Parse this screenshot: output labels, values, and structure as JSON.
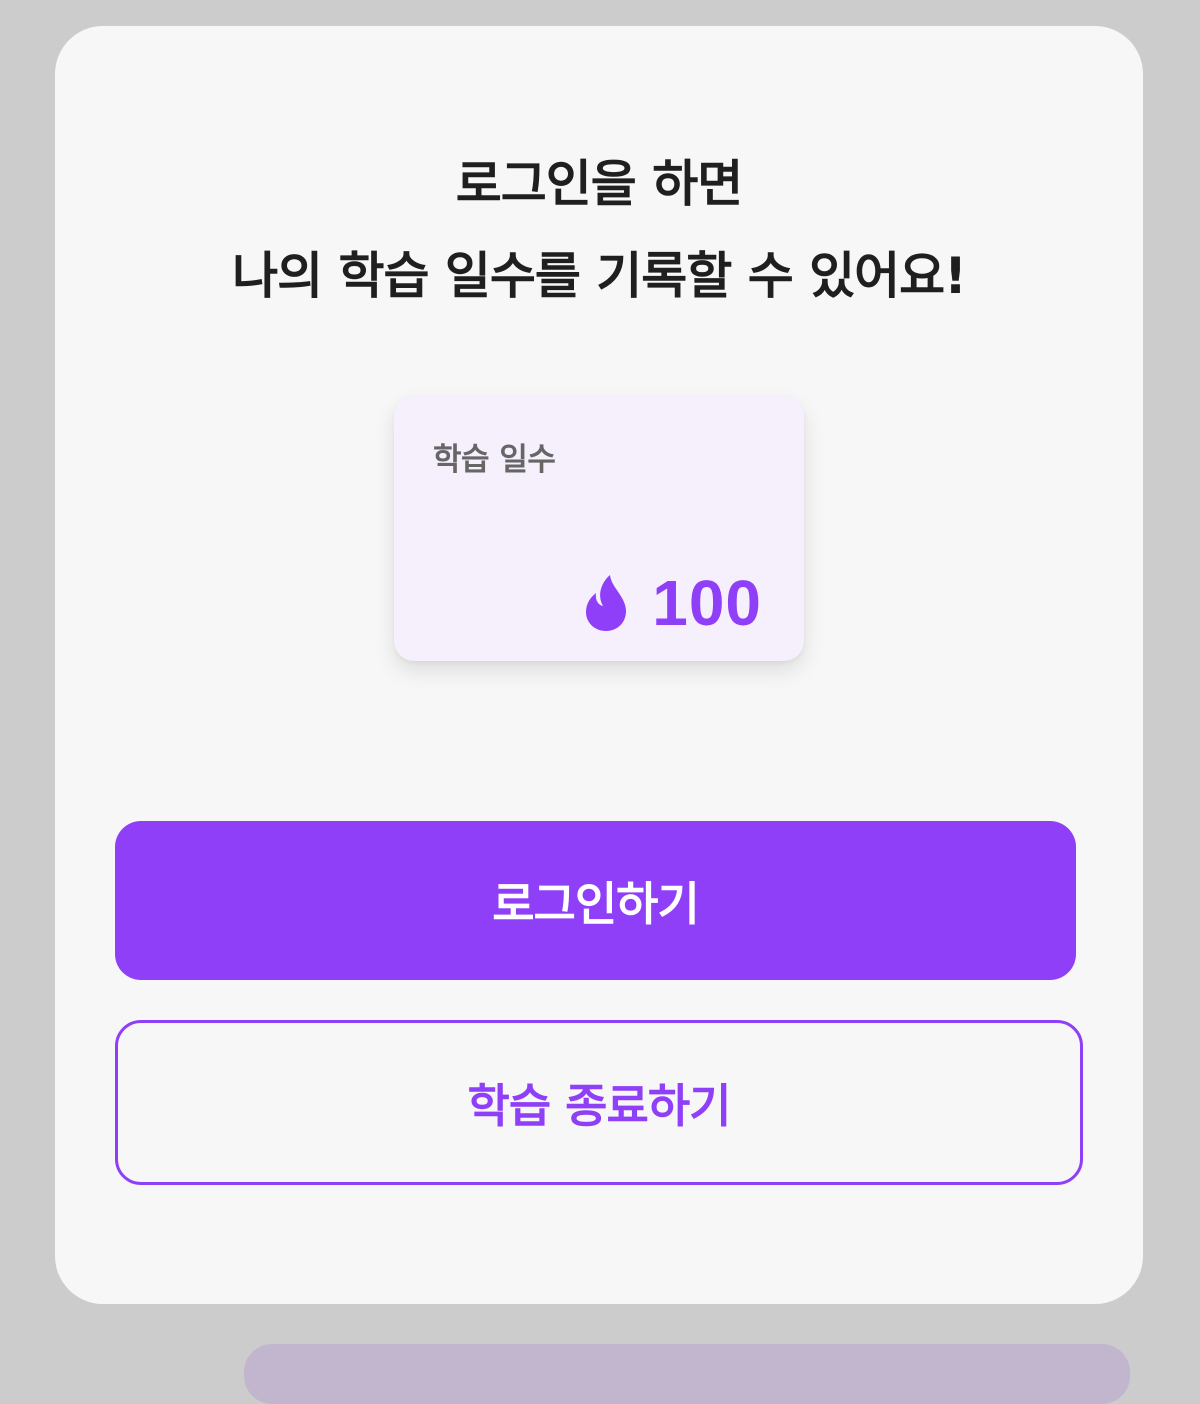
{
  "modal": {
    "title_line_1": "로그인을 하면",
    "title_line_2": "나의 학습 일수를 기록할 수 있어요!"
  },
  "stat_card": {
    "label": "학습 일수",
    "icon": "flame-icon",
    "value": "100"
  },
  "buttons": {
    "login_label": "로그인하기",
    "end_study_label": "학습 종료하기"
  },
  "colors": {
    "accent": "#8f3ff7",
    "card_background": "#f6f0fd",
    "modal_background": "#f7f7f7",
    "overlay": "#cccccc",
    "title_text": "#1f1f1f",
    "label_text": "#666666"
  }
}
